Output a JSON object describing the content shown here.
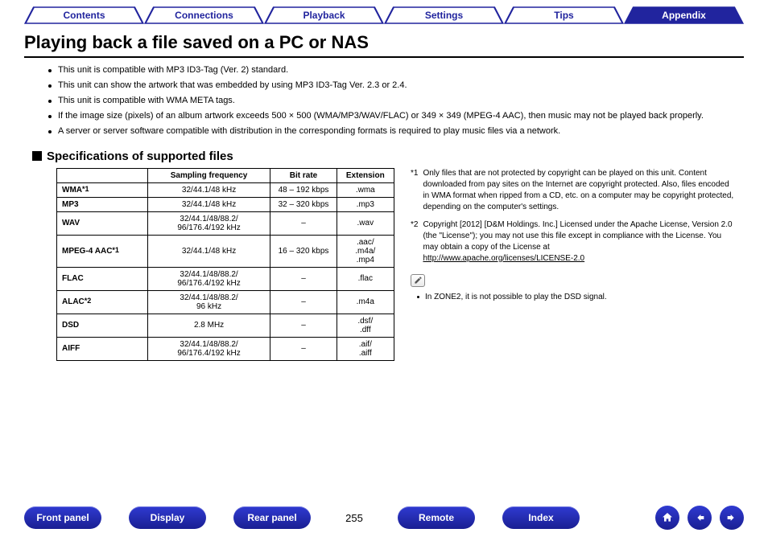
{
  "tabs": {
    "items": [
      {
        "label": "Contents",
        "active": false
      },
      {
        "label": "Connections",
        "active": false
      },
      {
        "label": "Playback",
        "active": false
      },
      {
        "label": "Settings",
        "active": false
      },
      {
        "label": "Tips",
        "active": false
      },
      {
        "label": "Appendix",
        "active": true
      }
    ]
  },
  "title": "Playing back a file saved on a PC or NAS",
  "notes": [
    "This unit is compatible with MP3 ID3-Tag (Ver. 2) standard.",
    "This unit can show the artwork that was embedded by using MP3 ID3-Tag Ver. 2.3 or 2.4.",
    "This unit is compatible with WMA META tags.",
    "If the image size (pixels) of an album artwork exceeds 500 × 500 (WMA/MP3/WAV/FLAC) or 349 × 349 (MPEG-4 AAC), then music may not be played back properly.",
    "A server or server software compatible with distribution in the corresponding formats is required to play music files via a network."
  ],
  "subheading": "Specifications of supported files",
  "table": {
    "headers": [
      "",
      "Sampling frequency",
      "Bit rate",
      "Extension"
    ],
    "rows": [
      {
        "name": "WMA",
        "note": "1",
        "freq": "32/44.1/48 kHz",
        "rate": "48 – 192 kbps",
        "ext": ".wma"
      },
      {
        "name": "MP3",
        "note": "",
        "freq": "32/44.1/48 kHz",
        "rate": "32 – 320 kbps",
        "ext": ".mp3"
      },
      {
        "name": "WAV",
        "note": "",
        "freq": "32/44.1/48/88.2/\n96/176.4/192 kHz",
        "rate": "–",
        "ext": ".wav"
      },
      {
        "name": "MPEG-4 AAC",
        "note": "1",
        "freq": "32/44.1/48 kHz",
        "rate": "16 – 320 kbps",
        "ext": ".aac/\n.m4a/\n.mp4"
      },
      {
        "name": "FLAC",
        "note": "",
        "freq": "32/44.1/48/88.2/\n96/176.4/192 kHz",
        "rate": "–",
        "ext": ".flac"
      },
      {
        "name": "ALAC",
        "note": "2",
        "freq": "32/44.1/48/88.2/\n96 kHz",
        "rate": "–",
        "ext": ".m4a"
      },
      {
        "name": "DSD",
        "note": "",
        "freq": "2.8 MHz",
        "rate": "–",
        "ext": ".dsf/\n.dff"
      },
      {
        "name": "AIFF",
        "note": "",
        "freq": "32/44.1/48/88.2/\n96/176.4/192 kHz",
        "rate": "–",
        "ext": ".aif/\n.aiff"
      }
    ]
  },
  "footnotes": [
    {
      "mark": "*1",
      "text": "Only files that are not protected by copyright can be played on this unit. Content downloaded from pay sites on the Internet are copyright protected. Also, files encoded in WMA format when ripped from a CD, etc. on a computer may be copyright protected, depending on the computer's settings."
    },
    {
      "mark": "*2",
      "text": "Copyright [2012] [D&M Holdings. Inc.] Licensed under the Apache License, Version 2.0 (the \"License\"); you may not use this file except in compliance with the License. You may obtain a copy of the License at",
      "link": "http://www.apache.org/licenses/LICENSE-2.0"
    }
  ],
  "zone_note": "In ZONE2, it is not possible to play the DSD signal.",
  "bottom": {
    "buttons_left": [
      "Front panel",
      "Display",
      "Rear panel"
    ],
    "page": "255",
    "buttons_right": [
      "Remote",
      "Index"
    ]
  }
}
